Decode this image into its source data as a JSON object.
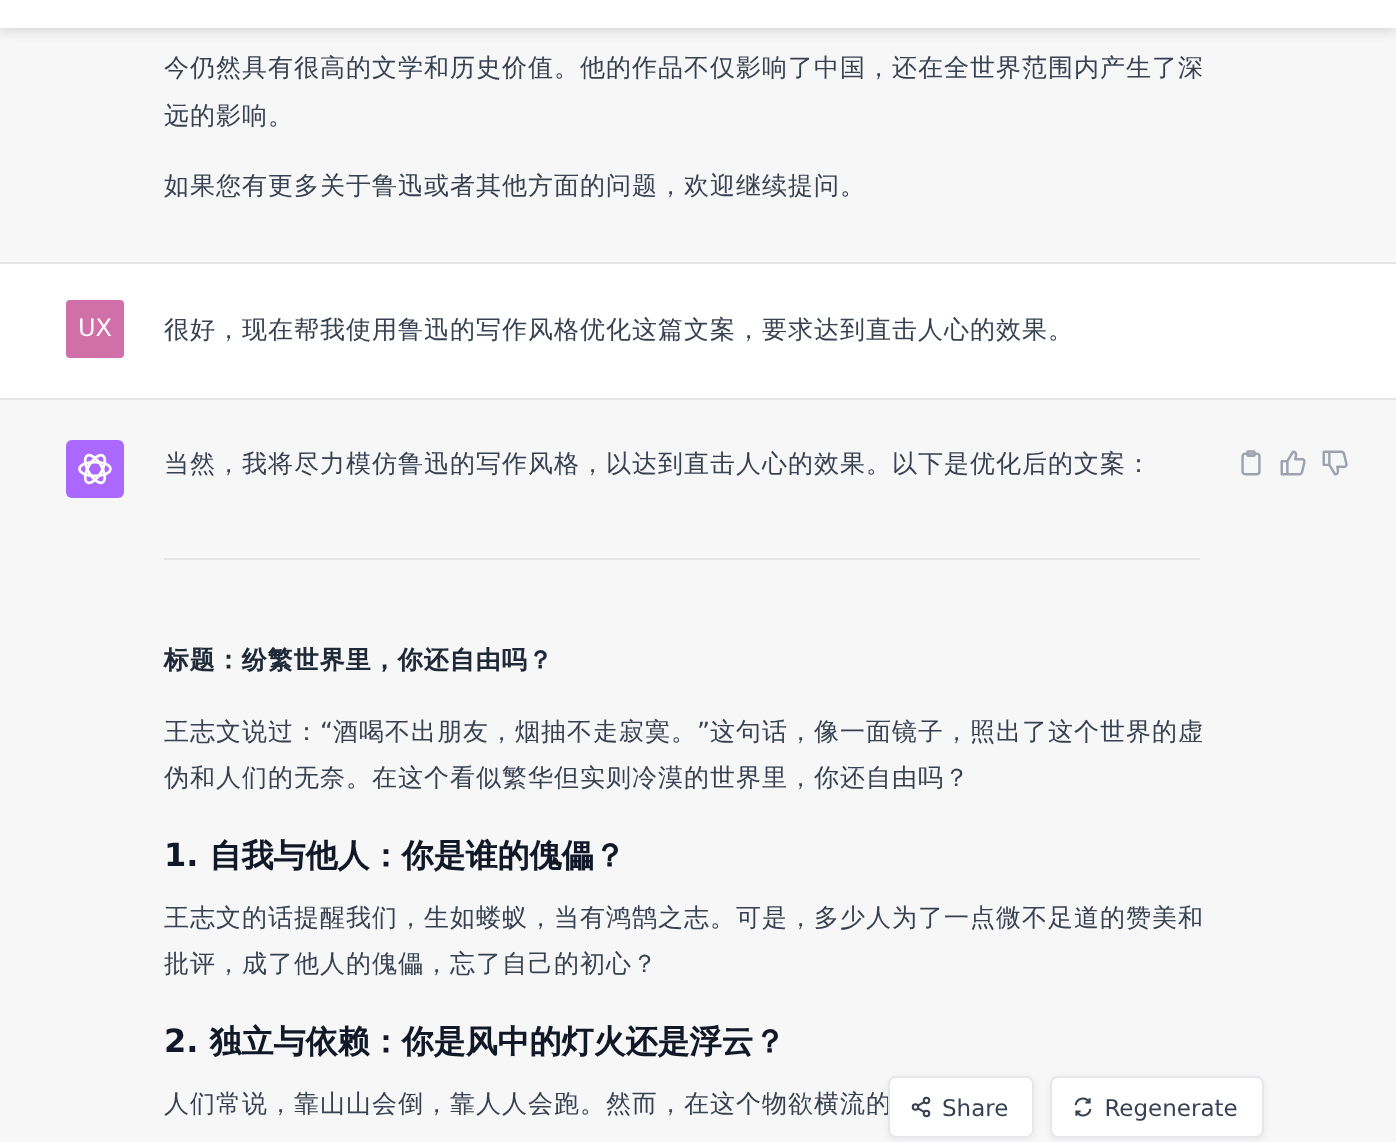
{
  "messages": [
    {
      "kind": "assistant_cont",
      "actions": false,
      "blocks": [
        {
          "kind": "paragraph",
          "text": "今仍然具有很高的文学和历史价值。他的作品不仅影响了中国，还在全世界范围内产生了深远的影响。"
        },
        {
          "kind": "paragraph",
          "text": "如果您有更多关于鲁迅或者其他方面的问题，欢迎继续提问。"
        }
      ]
    },
    {
      "kind": "user",
      "avatar": "UX",
      "actions": false,
      "blocks": [
        {
          "kind": "paragraph",
          "text": "很好，现在帮我使用鲁迅的写作风格优化这篇文案，要求达到直击人心的效果。"
        }
      ]
    },
    {
      "kind": "assistant",
      "actions": true,
      "blocks": [
        {
          "kind": "paragraph",
          "text": "当然，我将尽力模仿鲁迅的写作风格，以达到直击人心的效果。以下是优化后的文案："
        },
        {
          "kind": "rule"
        },
        {
          "kind": "title",
          "text": "标题：纷繁世界里，你还自由吗？"
        },
        {
          "kind": "paragraph",
          "text": "王志文说过：“酒喝不出朋友，烟抽不走寂寞。”这句话，像一面镜子，照出了这个世界的虚伪和人们的无奈。在这个看似繁华但实则冷漠的世界里，你还自由吗？"
        },
        {
          "kind": "heading",
          "text": "1. 自我与他人：你是谁的傀儡？"
        },
        {
          "kind": "paragraph",
          "text": "王志文的话提醒我们，生如蝼蚁，当有鸿鹄之志。可是，多少人为了一点微不足道的赞美和批评，成了他人的傀儡，忘了自己的初心？"
        },
        {
          "kind": "heading",
          "text": "2. 独立与依赖：你是风中的灯火还是浮云？"
        },
        {
          "kind": "paragraph",
          "text": "人们常说，靠山山会倒，靠人人会跑。然而，在这个物欲横流的"
        }
      ]
    }
  ],
  "floating_buttons": [
    {
      "label": "Share"
    },
    {
      "label": "Regenerate"
    }
  ]
}
